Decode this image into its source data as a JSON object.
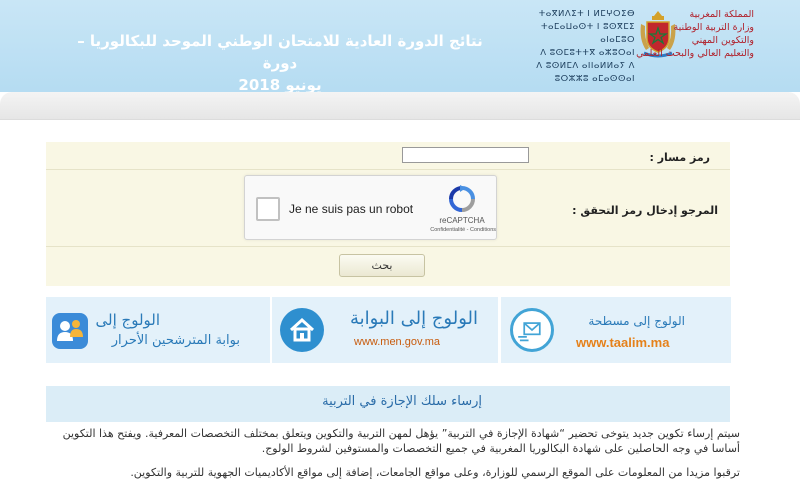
{
  "header": {
    "title_line1": "نتائج الدورة العادية للامتحان الوطني الموحد للبكالوريا – دورة",
    "title_line2": "يونيو 2018",
    "ministry_ar": [
      "المملكة المغربية",
      "وزارة التربية الوطنية",
      "والتكوين المهني",
      "والتعليم العالي والبحث العلمي"
    ],
    "ministry_tz": [
      "ⵜⴰⴳⵍⴷⵉⵜ ⵏ ⵍⵎⵖⵔⵉⴱ",
      "ⵜⴰⵎⴰⵡⴰⵙⵜ ⵏ ⵓⵙⴳⵎⵉ ⴰⵏⴰⵎⵓⵔ",
      "ⴷ ⵓⵙⵎⵓⵜⵜⴳ ⴰⵣⵓⵔⴰⵏ",
      "ⴷ ⵓⵙⵍⵎⴷ ⴰⵏⵏⴰⵍⵍⴰⵢ ⴷ ⵓⵔⵣⵣⵓ ⴰⵎⴰⵙⵙⴰⵏ"
    ]
  },
  "form": {
    "code_label": "رمز مسار :",
    "code_value": "",
    "verify_label": "المرجو إدخال رمز التحقق :",
    "search_button": "بحث"
  },
  "recaptcha": {
    "checkbox_label": "Je ne suis pas un robot",
    "brand": "reCAPTCHA",
    "terms": "Confidentialité - Conditions"
  },
  "banners": {
    "taalim": {
      "title": "الولوج إلى مسطحة",
      "url": "www.taalim.ma",
      "icon": "envelope-icon"
    },
    "men": {
      "title": "الولوج إلى البوابة",
      "url": "www.men.gov.ma",
      "icon": "home-icon"
    },
    "free": {
      "title": "الولوج إلى",
      "subtitle": "بوابة المترشحين الأحرار",
      "icon": "users-icon"
    }
  },
  "news": {
    "title": "إرساء سلك الإجازة في التربية",
    "paragraph1": "سيتم إرساء تكوين جديد يتوخى تحضير “شهادة الإجازة في التربية” يؤهل لمهن التربية والتكوين ويتعلق بمختلف التخصصات المعرفية. ويفتح هذا التكوين أساسا في وجه الحاصلين على شهادة البكالوريا المغربية في جميع التخصصات والمستوفين لشروط الولوج.",
    "paragraph2": "ترقبوا مزيدا من المعلومات على الموقع الرسمي للوزارة، وعلى مواقع الجامعات، إضافة إلى مواقع الأكاديميات الجهوية للتربية والتكوين."
  },
  "colors": {
    "header_bg": "#bde0f4",
    "banner_bg": "#e3f1fa",
    "form_bg": "#f9f7e4",
    "accent_blue": "#2a7ab8",
    "accent_orange": "#e5811a"
  }
}
